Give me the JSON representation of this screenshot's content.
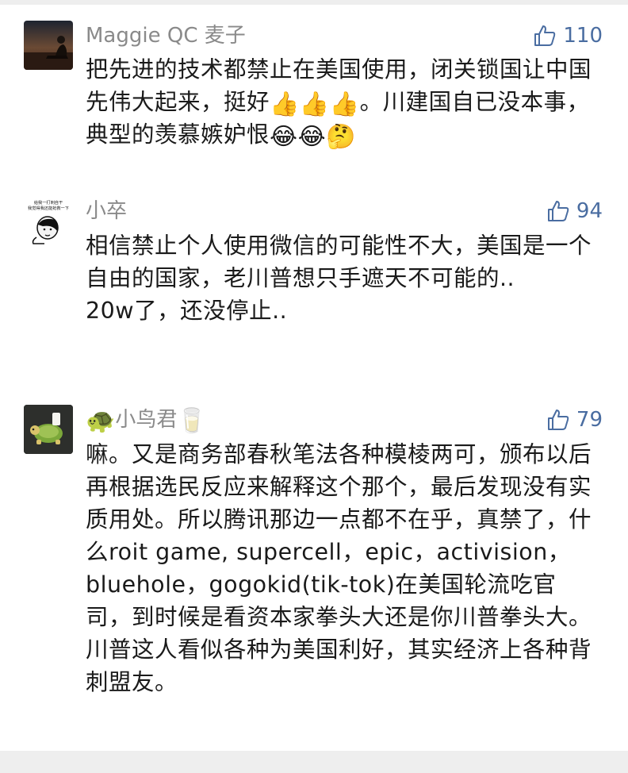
{
  "comments": [
    {
      "username": "Maggie QC 麦子",
      "likes": "110",
      "text_a": "把先进的技术都禁止在美国使用，闭关锁国让中国先伟大起来，挺好",
      "emoji_a": "👍👍👍",
      "text_b": "。川建国自已没本事，典型的羡慕嫉妒恨",
      "emoji_b": "😂😂🤔"
    },
    {
      "username": "小卒",
      "likes": "94",
      "avatar_caption": "给我一打刺自干 我觉得我还能抢救一下",
      "text": "相信禁止个人使用微信的可能性不大，美国是一个自由的国家，老川普想只手遮天不可能的..\n20w了，还没停止.."
    },
    {
      "username_prefix": "🐢",
      "username": "小鸟君",
      "username_suffix": "🥛",
      "likes": "79",
      "text": "嘛。又是商务部春秋笔法各种模棱两可，颁布以后再根据选民反应来解释这个那个，最后发现没有实质用处。所以腾讯那边一点都不在乎，真禁了，什么roit game, supercell，epic，activision，bluehole，gogokid(tik-tok)在美国轮流吃官司，到时候是看资本家拳头大还是你川普拳头大。\n川普这人看似各种为美国利好，其实经济上各种背刺盟友。"
    }
  ],
  "colors": {
    "background": "#eeeeee",
    "card": "#ffffff",
    "username": "#8a8a8a",
    "like": "#4a6da1",
    "text": "#1a1a1a"
  },
  "icons": {
    "like": "thumbs-up-outline-icon"
  }
}
